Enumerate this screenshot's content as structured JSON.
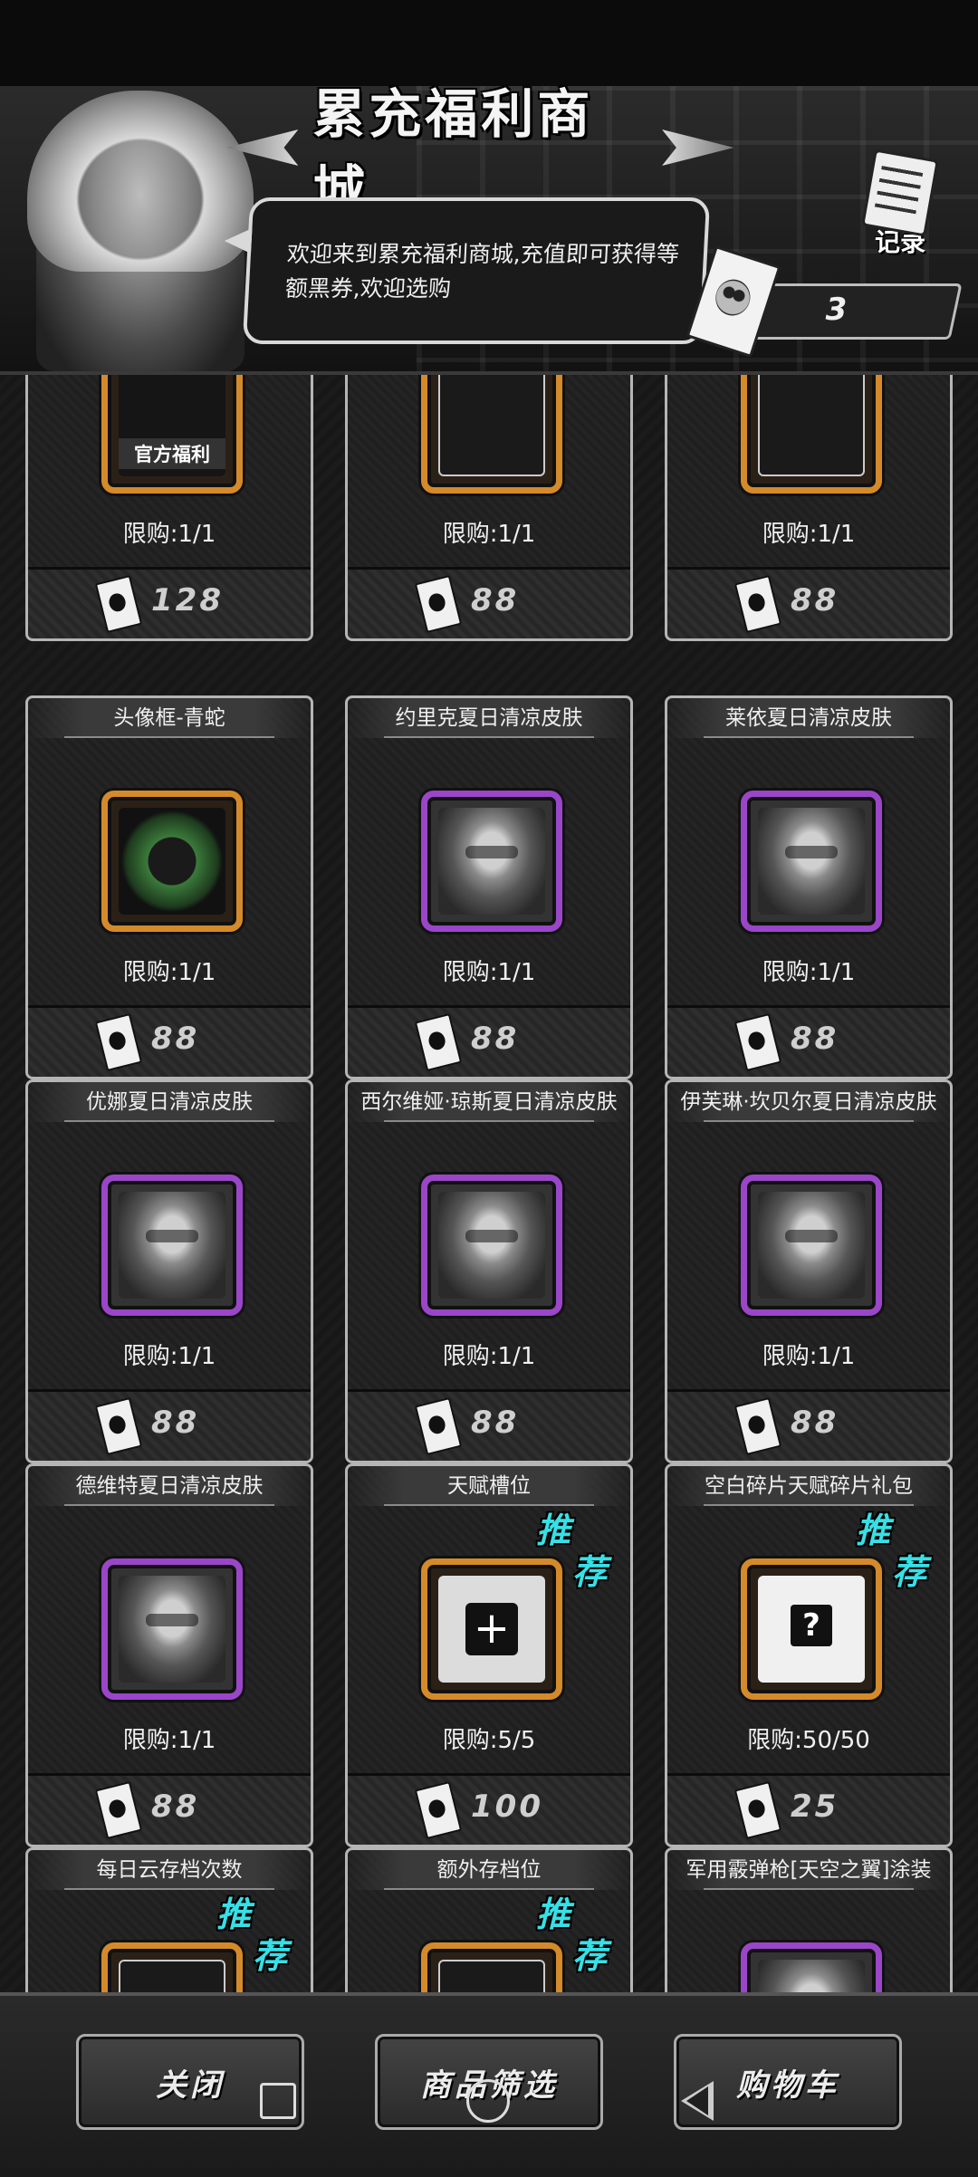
{
  "header": {
    "title": "累充福利商城",
    "welcome_text": "欢迎来到累充福利商城,充值即可获得等额黑券,欢迎选购",
    "record_label": "记录",
    "balance": "3"
  },
  "cards": [
    {
      "title": "",
      "icon": "official-benefit-icon",
      "icon_label": "官方福利",
      "frame": "orange",
      "limit": "限购:1/1",
      "price": "128"
    },
    {
      "title": "",
      "icon": "card-back-icon",
      "frame": "orange",
      "limit": "限购:1/1",
      "price": "88"
    },
    {
      "title": "",
      "icon": "card-back-icon",
      "frame": "orange",
      "limit": "限购:1/1",
      "price": "88"
    },
    {
      "title": "头像框-青蛇",
      "icon": "green-snake-frame-icon",
      "frame": "orange",
      "limit": "限购:1/1",
      "price": "88"
    },
    {
      "title": "约里克夏日清凉皮肤",
      "icon": "character-portrait-icon",
      "frame": "purple",
      "limit": "限购:1/1",
      "price": "88"
    },
    {
      "title": "莱依夏日清凉皮肤",
      "icon": "character-portrait-icon",
      "frame": "purple",
      "limit": "限购:1/1",
      "price": "88"
    },
    {
      "title": "优娜夏日清凉皮肤",
      "icon": "character-portrait-icon",
      "frame": "purple",
      "limit": "限购:1/1",
      "price": "88"
    },
    {
      "title": "西尔维娅·琼斯夏日清凉皮肤",
      "icon": "character-portrait-icon",
      "frame": "purple",
      "limit": "限购:1/1",
      "price": "88"
    },
    {
      "title": "伊芙琳·坎贝尔夏日清凉皮肤",
      "icon": "character-portrait-icon",
      "frame": "purple",
      "limit": "限购:1/1",
      "price": "88"
    },
    {
      "title": "德维特夏日清凉皮肤",
      "icon": "character-portrait-icon",
      "frame": "purple",
      "limit": "限购:1/1",
      "price": "88"
    },
    {
      "title": "天赋槽位",
      "icon": "talent-slot-icon",
      "frame": "orange",
      "limit": "限购:5/5",
      "price": "100",
      "recommend": "推荐"
    },
    {
      "title": "空白碎片天赋碎片礼包",
      "icon": "gift-box-icon",
      "frame": "orange",
      "limit": "限购:50/50",
      "price": "25",
      "recommend": "推荐"
    },
    {
      "title": "每日云存档次数",
      "icon": "cloud-save-icon",
      "frame": "orange",
      "recommend": "推荐"
    },
    {
      "title": "额外存档位",
      "icon": "save-slot-icon",
      "frame": "orange",
      "recommend": "推荐"
    },
    {
      "title": "军用霰弹枪[天空之翼]涂装",
      "icon": "shotgun-skin-icon",
      "frame": "purple"
    }
  ],
  "recommend_label_1": "推",
  "recommend_label_2": "荐",
  "bottom": {
    "close": "关闭",
    "filter": "商品筛选",
    "cart": "购物车"
  },
  "colors": {
    "orange_frame": "#d48a2a",
    "purple_frame": "#9a46c8",
    "recommend": "#36e0e6"
  }
}
